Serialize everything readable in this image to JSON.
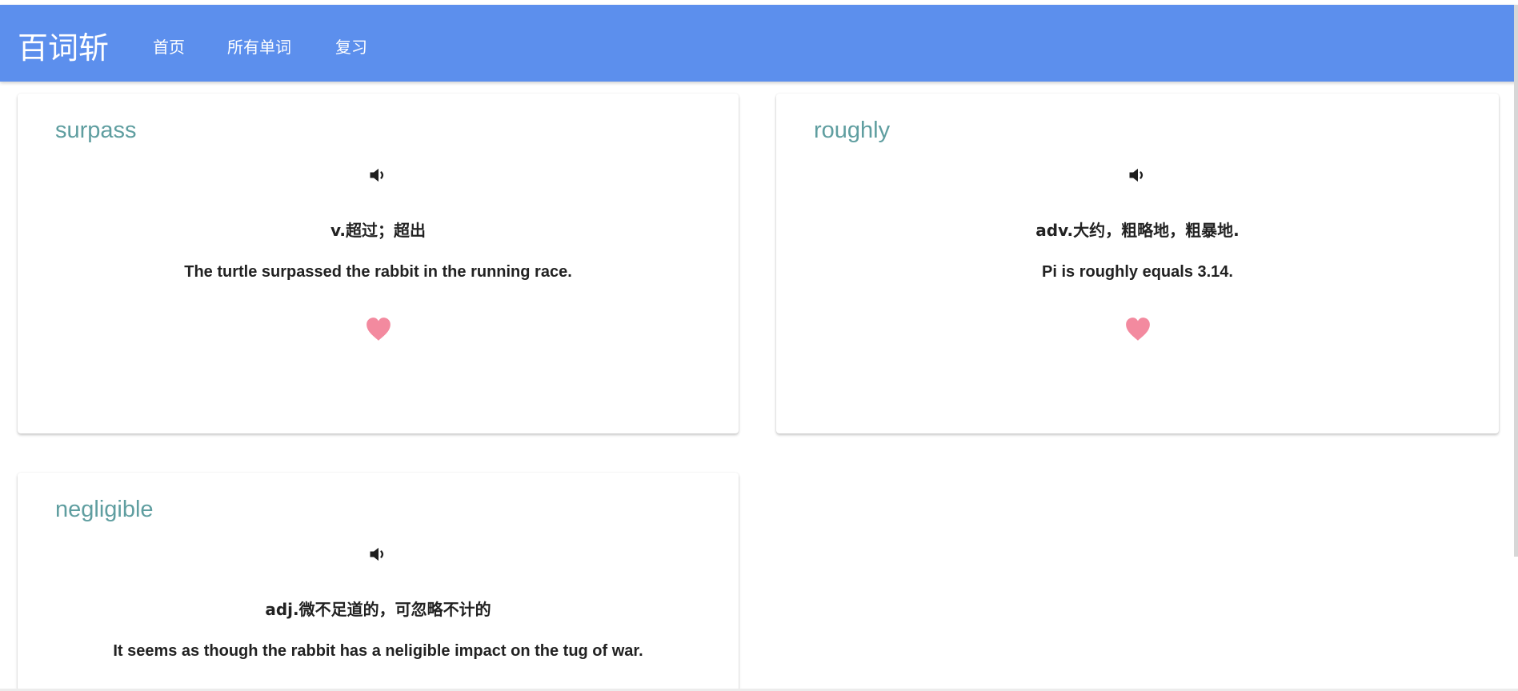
{
  "navbar": {
    "brand": "百词斩",
    "links": [
      "首页",
      "所有单词",
      "复习"
    ]
  },
  "cards": [
    {
      "word": "surpass",
      "meaning": "v.超过；超出",
      "example": "The turtle surpassed the rabbit in the running race.",
      "speaker_icon": "speaker-icon",
      "heart_icon": "heart-icon"
    },
    {
      "word": "roughly",
      "meaning": "adv.大约，粗略地，粗暴地.",
      "example": "Pi is roughly equals 3.14.",
      "speaker_icon": "speaker-icon",
      "heart_icon": "heart-icon"
    },
    {
      "word": "negligible",
      "meaning": "adj.微不足道的，可忽略不计的",
      "example": "It seems as though the rabbit has a neligible impact on the tug of war.",
      "speaker_icon": "speaker-icon",
      "heart_icon": "heart-icon"
    }
  ],
  "colors": {
    "navbar": "#5c8fed",
    "word": "#5f9ea0",
    "heart": "#f38a9f",
    "text": "#222222"
  }
}
